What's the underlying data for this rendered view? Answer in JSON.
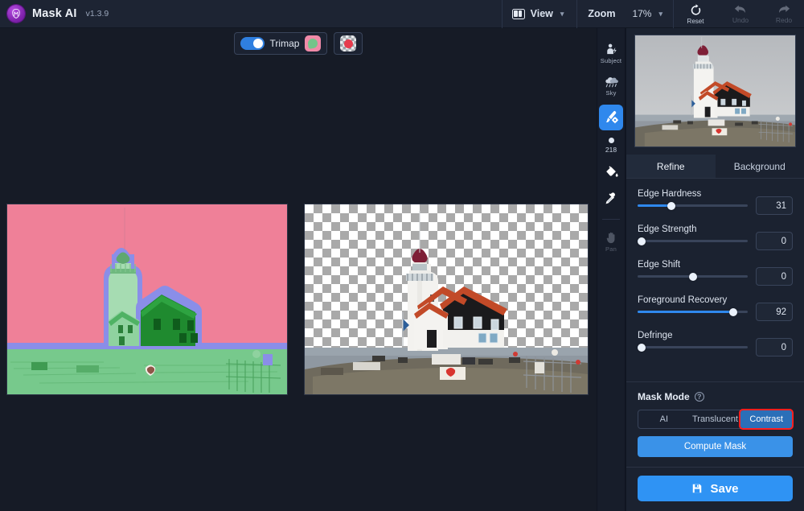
{
  "app": {
    "name": "Mask AI",
    "version": "v1.3.9",
    "logo_icon": "mask-ai-logo-icon"
  },
  "topbar": {
    "view_label": "View",
    "view_icon": "view-panels-icon",
    "view_caret_icon": "chevron-down-icon",
    "zoom_label": "Zoom",
    "zoom_value": "17%",
    "zoom_caret_icon": "chevron-down-icon",
    "reset_label": "Reset",
    "reset_icon": "reset-rotate-icon",
    "undo_label": "Undo",
    "undo_icon": "undo-arrow-icon",
    "redo_label": "Redo",
    "redo_icon": "redo-arrow-icon"
  },
  "canvas": {
    "trimap_toggle_label": "Trimap",
    "trimap_toggle_on": "on",
    "trimap_swatch_icon": "trimap-green-pink-swatch-icon",
    "transparency_swatch_icon": "checkerboard-red-dot-swatch-icon",
    "left_image_name": "trimap-overlay-lighthouse",
    "right_image_name": "cutout-lighthouse-transparent"
  },
  "toolrail": {
    "items": [
      {
        "label": "Subject",
        "icon": "subject-person-icon",
        "state": "normal"
      },
      {
        "label": "Sky",
        "icon": "sky-clouds-icon",
        "state": "normal"
      },
      {
        "label": "",
        "icon": "brush-settings-icon",
        "state": "active"
      },
      {
        "label": "",
        "icon": "paint-bucket-icon",
        "state": "normal"
      },
      {
        "label": "",
        "icon": "eyedropper-icon",
        "state": "normal"
      },
      {
        "label": "Pan",
        "icon": "pan-hand-icon",
        "state": "dim"
      }
    ],
    "brush_size": "218",
    "brush_dot_icon": "brush-size-dot-icon"
  },
  "panel": {
    "preview_name": "source-image-preview",
    "tabs": [
      {
        "label": "Refine",
        "active": true
      },
      {
        "label": "Background",
        "active": false
      }
    ],
    "sliders": [
      {
        "name": "Edge Hardness",
        "value": "31",
        "pct": 31
      },
      {
        "name": "Edge Strength",
        "value": "0",
        "pct": 4
      },
      {
        "name": "Edge Shift",
        "value": "0",
        "pct": 50
      },
      {
        "name": "Foreground Recovery",
        "value": "92",
        "pct": 87
      },
      {
        "name": "Defringe",
        "value": "0",
        "pct": 4
      }
    ],
    "mask_mode": {
      "title": "Mask Mode",
      "help_icon": "help-question-icon",
      "help_glyph": "?",
      "options": [
        {
          "label": "AI",
          "selected": false
        },
        {
          "label": "Translucent",
          "selected": false
        },
        {
          "label": "Contrast",
          "selected": true
        }
      ],
      "compute_label": "Compute Mask"
    },
    "save_label": "Save",
    "save_icon": "save-disk-icon"
  },
  "colors": {
    "accent": "#2f88ed",
    "save_blue": "#2f93f4",
    "panel_bg": "#1b2230",
    "canvas_bg": "#161b26",
    "topbar_bg": "#1d2433",
    "highlight_red": "#ff1f1f",
    "trimap_pink": "#ef8098",
    "trimap_green": "#77c98c",
    "trimap_blue": "#8a8ee8"
  }
}
